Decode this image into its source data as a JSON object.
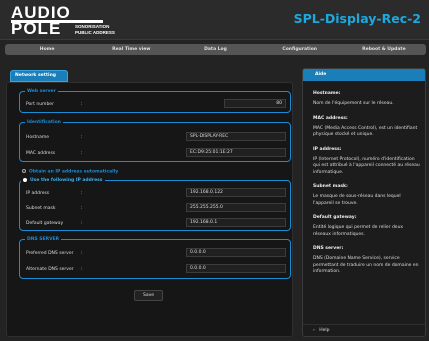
{
  "logo": {
    "line1": "AUDIO",
    "line2": "POLE",
    "sub1": "SONORISATION",
    "sub2": "PUBLIC ADDRESS"
  },
  "site_title": "SPL-Display-Rec-2",
  "nav": [
    "Home",
    "Real Time view",
    "Data Log",
    "Configuration",
    "Reboot & Update"
  ],
  "tab_label": "Network setting",
  "web_server": {
    "title": "Web server",
    "port_label": "Port number",
    "port_value": "80"
  },
  "identification": {
    "title": "Identification",
    "hostname_label": "Hostname",
    "hostname_value": "SPL-DISPLAY-REC",
    "mac_label": "MAC address",
    "mac_value": "EC:D9:25:01:1E:27"
  },
  "ip_mode": {
    "auto_label": "Obtain an IP address automatically",
    "manual_label": "Use the following IP address",
    "ip_label": "IP address",
    "ip_value": "192.168.0.122",
    "subnet_label": "Subnet mask",
    "subnet_value": "255.255.255.0",
    "gateway_label": "Default gateway",
    "gateway_value": "192.168.0.1"
  },
  "dns": {
    "title": "DNS SERVER",
    "preferred_label": "Preferred DNS server",
    "preferred_value": "0.0.0.0",
    "alternate_label": "Alternate DNS server",
    "alternate_value": "0.0.0.0"
  },
  "colon": ":",
  "save_label": "Save",
  "aide": {
    "title": "Aide",
    "help": [
      {
        "h": "Hostname:",
        "t": "Nom de l'équipement sur le réseau."
      },
      {
        "h": "MAC address:",
        "t": "MAC (Media Access Control), est un identifiant physique stocké et unique."
      },
      {
        "h": "IP address:",
        "t": "IP (Internet Protocol), numéro d'identification qui est attribué à l'appareil connecté au réseau informatique."
      },
      {
        "h": "Subnet mask:",
        "t": "Le masque de sous-réseau dans lequel l'appareil se trouve."
      },
      {
        "h": "Default gateway:",
        "t": "Entité logique qui permet de relier deux réseaux informatiques."
      },
      {
        "h": "DNS server:",
        "t": "DNS (Domaine Name Service), service permettant de traduire un nom de domaine en information."
      }
    ],
    "footer": "Help"
  },
  "colors": {
    "accent": "#1a8cd6",
    "tab_blue": "#1a7fb8",
    "title_blue": "#1ea8e0",
    "background": "#232323"
  }
}
